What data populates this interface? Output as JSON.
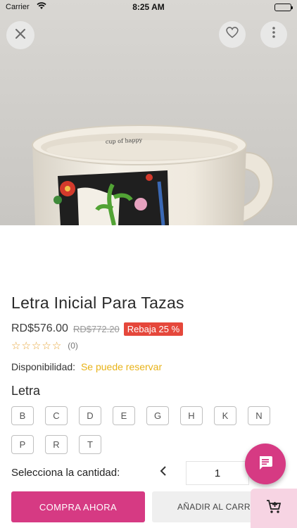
{
  "status_bar": {
    "carrier": "Carrier",
    "time": "8:25 AM"
  },
  "product": {
    "title": "Letra Inicial Para Tazas",
    "price": "RD$576.00",
    "old_price": "RD$772.20",
    "discount": "Rebaja 25 %",
    "rating": {
      "stars": 0,
      "max": 5,
      "count_label": "(0)"
    },
    "image_caption": "cup of happy"
  },
  "availability": {
    "label": "Disponibilidad:",
    "value": "Se puede reservar"
  },
  "options": {
    "heading": "Letra",
    "letters": [
      "B",
      "C",
      "D",
      "E",
      "G",
      "H",
      "K",
      "N",
      "P",
      "R",
      "T"
    ]
  },
  "quantity": {
    "label": "Selecciona la cantidad:",
    "value": "1",
    "decrement_icon": "chevron-left-icon"
  },
  "actions": {
    "buy_now": "COMPRA AHORA",
    "add_to_cart": "AÑADIR AL CARRITO"
  },
  "icons": {
    "close": "close-icon",
    "favorite": "heart-icon",
    "more": "more-vertical-icon",
    "chat": "chat-icon",
    "cart": "add-cart-icon"
  },
  "colors": {
    "accent": "#d63a83",
    "discount": "#e5473b",
    "availability": "#e8b319",
    "stars": "#e7a53a"
  }
}
